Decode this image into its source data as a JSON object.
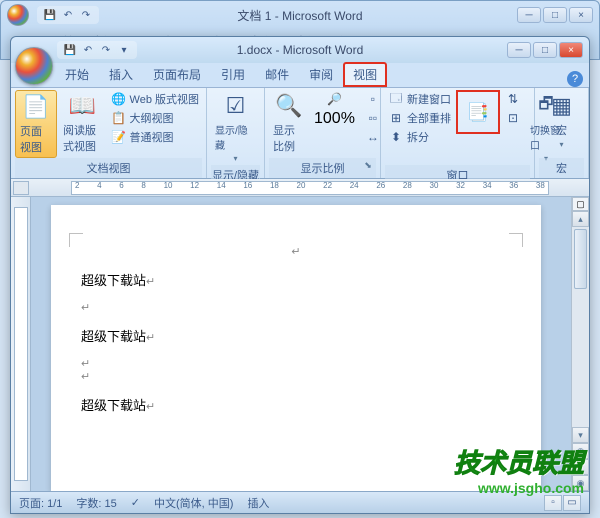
{
  "back_window": {
    "title": "文档 1 - Microsoft Word",
    "tabs": [
      "开始",
      "插入",
      "页面布局",
      "引用",
      "邮件",
      "审阅",
      "视图"
    ]
  },
  "front_window": {
    "title": "1.docx - Microsoft Word",
    "tabs": {
      "home": "开始",
      "insert": "插入",
      "layout": "页面布局",
      "references": "引用",
      "mailings": "邮件",
      "review": "审阅",
      "view": "视图"
    }
  },
  "ribbon": {
    "views_group": {
      "label": "文档视图",
      "page_view": "页面视图",
      "reading_view": "阅读版式视图",
      "web_view": "Web 版式视图",
      "outline_view": "大纲视图",
      "draft_view": "普通视图"
    },
    "show_hide": {
      "label": "显示/隐藏"
    },
    "zoom_group": {
      "label": "显示比例",
      "zoom": "显示比例",
      "percent_100": "100%"
    },
    "window_group": {
      "label": "窗口",
      "new_window": "新建窗口",
      "arrange_all": "全部重排",
      "split": "拆分",
      "switch_window": "切换窗口"
    },
    "macros": {
      "label": "宏",
      "btn": "宏"
    }
  },
  "ruler_marks": [
    "2",
    "4",
    "6",
    "8",
    "10",
    "12",
    "14",
    "16",
    "18",
    "20",
    "22",
    "24",
    "26",
    "28",
    "30",
    "32",
    "34",
    "36",
    "38"
  ],
  "document": {
    "line1": "超级下载站",
    "line2": "超级下载站",
    "line3": "超级下载站"
  },
  "statusbar": {
    "page": "页面: 1/1",
    "words": "字数: 15",
    "language": "中文(简体, 中国)",
    "insert": "插入"
  },
  "watermark": {
    "main": "技术员联盟",
    "sub": "www.jsgho.com"
  }
}
